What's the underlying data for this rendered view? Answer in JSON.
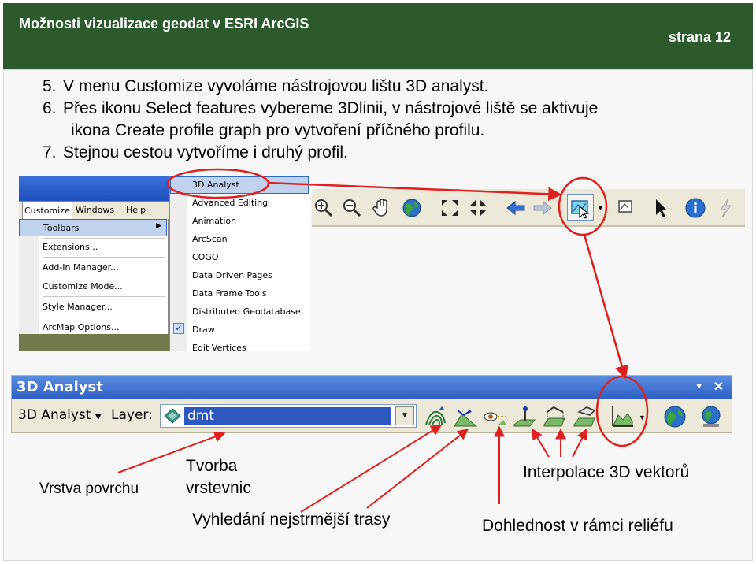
{
  "header": {
    "title": "Možnosti vizualizace geodat v ESRI ArcGIS",
    "page": "strana 12"
  },
  "steps": [
    {
      "num": "5.",
      "lines": [
        "V menu Customize vyvoláme nástrojovou lištu 3D analyst."
      ]
    },
    {
      "num": "6.",
      "lines": [
        "Přes ikonu Select features vybereme 3Dlinii, v nástrojové liště se aktivuje",
        "ikona Create profile graph pro vytvoření příčného profilu."
      ]
    },
    {
      "num": "7.",
      "lines": [
        "Stejnou cestou vytvoříme i druhý profil."
      ]
    }
  ],
  "customize_menu": {
    "menubar": [
      "Customize",
      "Windows",
      "Help"
    ],
    "items": [
      "Toolbars",
      "Extensions...",
      "Add-In Manager...",
      "Customize Mode...",
      "Style Manager...",
      "ArcMap Options..."
    ],
    "toolbars_submenu": [
      "3D Analyst",
      "Advanced Editing",
      "Animation",
      "ArcScan",
      "COGO",
      "Data Driven Pages",
      "Data Frame Tools",
      "Distributed Geodatabase",
      "Draw",
      "Edit Vertices"
    ]
  },
  "standard_toolbar": {
    "icons": [
      "zoom-in-icon",
      "zoom-out-icon",
      "pan-hand-icon",
      "full-extent-globe-icon",
      "fixed-zoom-in-icon",
      "fixed-zoom-out-icon",
      "back-arrow-icon",
      "forward-arrow-icon",
      "select-features-icon",
      "clear-selection-icon",
      "select-elements-arrow-icon",
      "identify-icon",
      "hyperlink-bolt-icon"
    ]
  },
  "analyst_toolbar": {
    "title": "3D Analyst",
    "dropdown_label": "3D Analyst",
    "layer_label": "Layer:",
    "layer_value": "dmt"
  },
  "annotations": {
    "surface_layer": "Vrstva povrchu",
    "contours_line1": "Tvorba",
    "contours_line2": "vrstevnic",
    "steepest_path": "Vyhledání nejstrmější trasy",
    "interpolate": "Interpolace 3D vektorů",
    "line_of_sight": "Dohlednost v rámci reliéfu"
  },
  "colors": {
    "header_bg": "#2c5a2c",
    "titlebar_blue": "#2e5fc4",
    "menu_highlight": "#c1d2ee",
    "arrow_red": "#e02020"
  }
}
